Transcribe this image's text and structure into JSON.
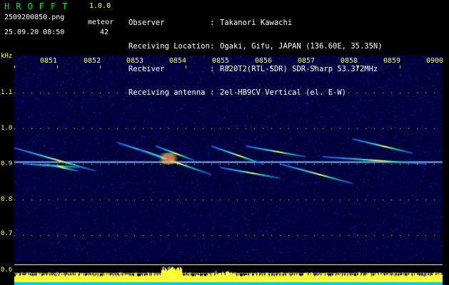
{
  "header": {
    "app_name": "HROFFT",
    "version": "1.0.0",
    "filename": "2509200850.png",
    "datetime": "25.09.20 08:50",
    "meteor_label": "meteor",
    "meteor_count": "42"
  },
  "info": [
    {
      "key": "Observer",
      "sep": ":",
      "value": "Takanori Kawachi"
    },
    {
      "key": "Receiving Location",
      "sep": ":",
      "value": "Ogaki, Gifu, JAPAN (136.60E, 35.35N)"
    },
    {
      "key": "Receiver",
      "sep": ":",
      "value": "R820T2(RTL-SDR) SDR-Sharp 53.372MHz"
    },
    {
      "key": "Receiving antenna",
      "sep": ":",
      "value": "2el-HB9CV Vertical (el. E-W)"
    }
  ],
  "chart_data": {
    "type": "heatmap",
    "ylabel": "kHz",
    "ylim": [
      0.6,
      1.2
    ],
    "yticks": [
      "1.1",
      "1.0",
      "0.9",
      "0.8",
      "0.7",
      "0.6"
    ],
    "xticks": [
      "0851",
      "0852",
      "0853",
      "0854",
      "0855",
      "0856",
      "0857",
      "0858",
      "0859",
      "0900"
    ],
    "carrier_khz": 0.905,
    "echoes": [
      {
        "t0": 0.0,
        "t1": 1.9,
        "f0": 0.945,
        "f1": 0.88
      },
      {
        "t0": 0.2,
        "t1": 1.6,
        "f0": 0.9,
        "f1": 0.89
      },
      {
        "t0": 0.7,
        "t1": 1.5,
        "f0": 0.9,
        "f1": 0.88
      },
      {
        "t0": 2.4,
        "t1": 3.7,
        "f0": 0.96,
        "f1": 0.91
      },
      {
        "t0": 2.9,
        "t1": 4.6,
        "f0": 0.94,
        "f1": 0.87
      },
      {
        "t0": 3.3,
        "t1": 4.2,
        "f0": 0.95,
        "f1": 0.91
      },
      {
        "t0": 4.6,
        "t1": 5.8,
        "f0": 0.95,
        "f1": 0.9
      },
      {
        "t0": 5.4,
        "t1": 6.8,
        "f0": 0.95,
        "f1": 0.92
      },
      {
        "t0": 6.2,
        "t1": 7.9,
        "f0": 0.9,
        "f1": 0.845
      },
      {
        "t0": 4.8,
        "t1": 6.2,
        "f0": 0.89,
        "f1": 0.86
      },
      {
        "t0": 7.9,
        "t1": 9.3,
        "f0": 0.97,
        "f1": 0.93
      },
      {
        "t0": 7.2,
        "t1": 9.6,
        "f0": 0.92,
        "f1": 0.9
      }
    ]
  },
  "colors": {
    "background": "#00003c",
    "axis_text": "#ffff33",
    "title_green": "#00e600",
    "level_bar": "#ffff33",
    "baseline": "#00ccff"
  }
}
